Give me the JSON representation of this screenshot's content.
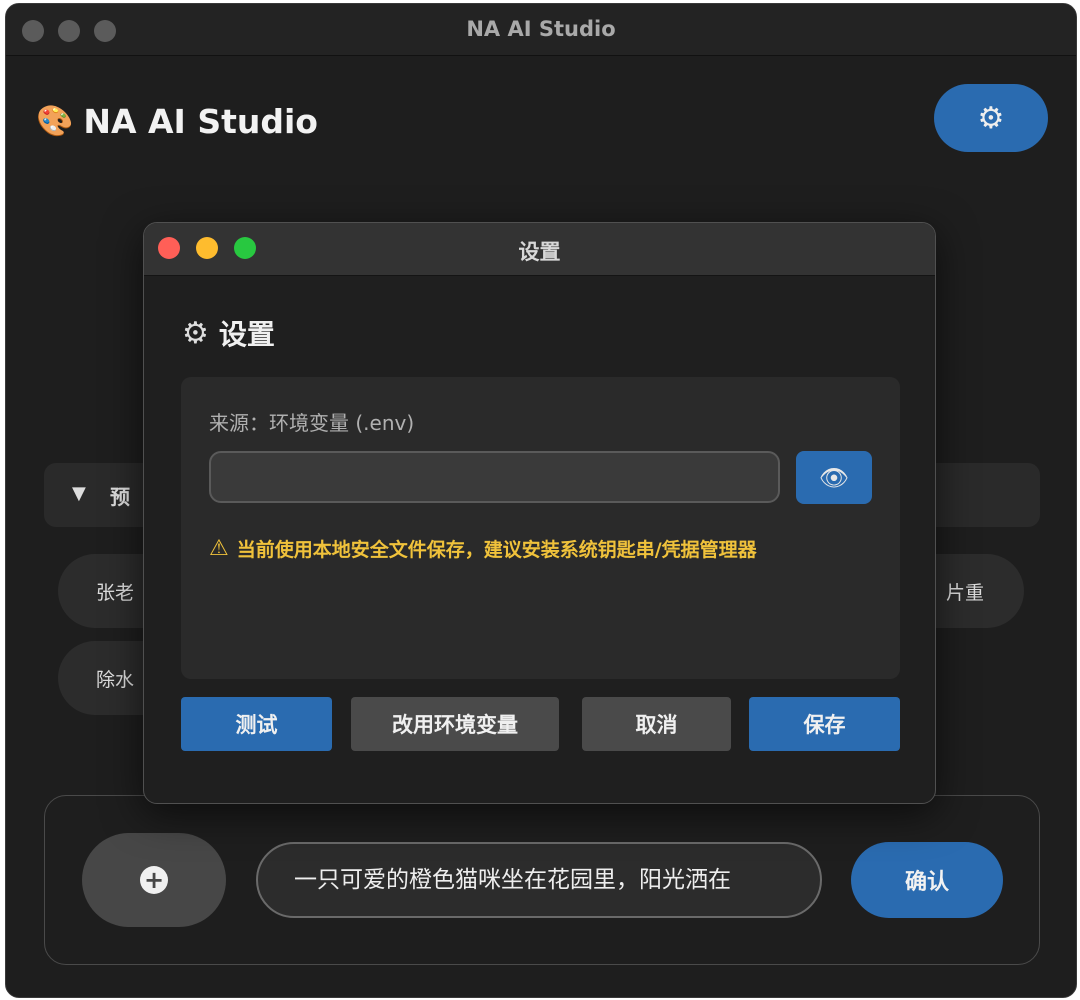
{
  "window": {
    "title": "NA AI Studio"
  },
  "app": {
    "logo_icon": "palette-icon",
    "title": "NA AI Studio"
  },
  "toolbar": {
    "settings_icon": "gear-icon"
  },
  "presets": {
    "toggle_arrow": "▼",
    "label_fragment": "预",
    "chips": [
      "张老",
      "除水",
      "片重"
    ]
  },
  "input_bar": {
    "add_icon": "plus-circle-icon",
    "prompt_value": "一只可爱的橙色猫咪坐在花园里，阳光洒在",
    "confirm_label": "确认"
  },
  "settings_dialog": {
    "window_title": "设置",
    "heading": "设置",
    "source_label": "来源：环境变量 (.env)",
    "api_key_value": "",
    "reveal_icon": "eye-icon",
    "warning_text": "当前使用本地安全文件保存，建议安装系统钥匙串/凭据管理器",
    "buttons": {
      "test": "测试",
      "use_env": "改用环境变量",
      "cancel": "取消",
      "save": "保存"
    }
  },
  "colors": {
    "accent_blue": "#2a6bb0",
    "warning": "#f0c23b",
    "close": "#ff5f57",
    "minimize": "#febc2e",
    "maximize": "#28c840"
  }
}
